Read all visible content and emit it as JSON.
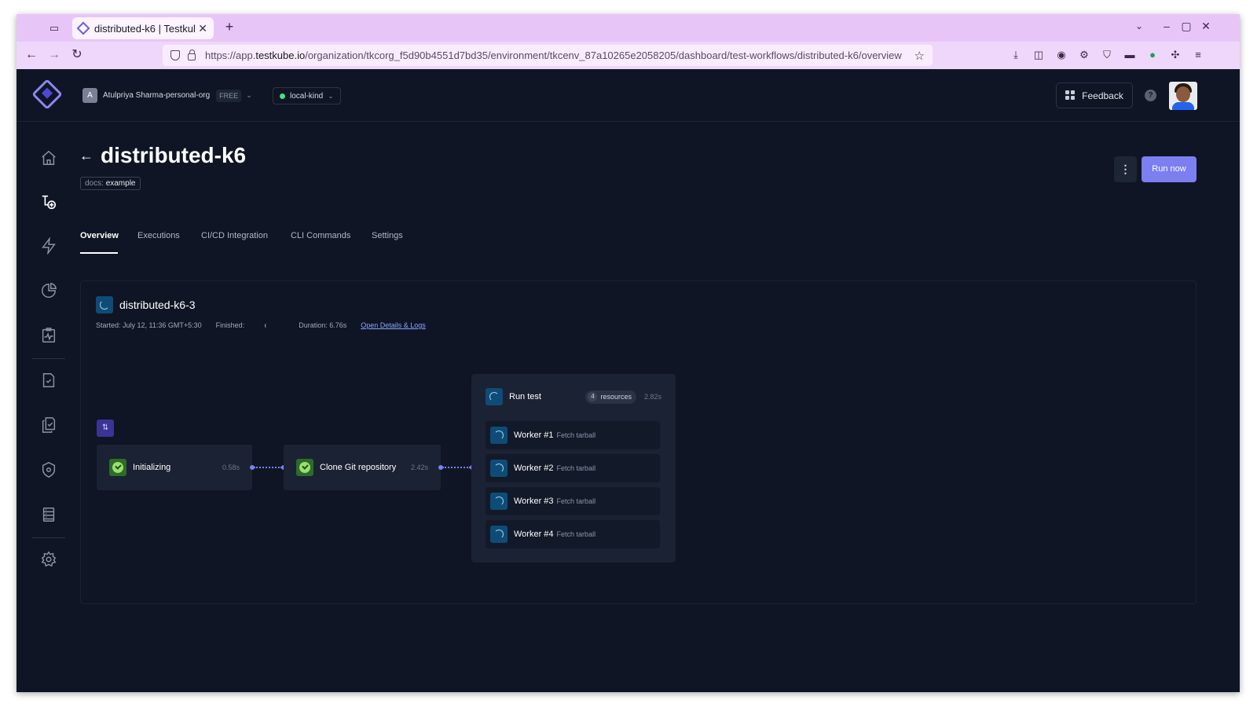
{
  "browser": {
    "tab_title": "distributed-k6 | Testkube",
    "url_prefix": "https://app.",
    "url_domain": "testkube.io",
    "url_path": "/organization/tkcorg_f5d90b4551d7bd35/environment/tkcenv_87a10265e2058205/dashboard/test-workflows/distributed-k6/overview"
  },
  "topbar": {
    "org_initial": "A",
    "org_name": "Atulpriya Sharma-personal-org",
    "org_plan": "FREE",
    "environment": "local-kind",
    "environment_status_color": "#4ade80",
    "feedback_label": "Feedback",
    "help_label": "?"
  },
  "sidebar": {
    "items": [
      "home-icon",
      "test-workflows-icon",
      "triggers-icon",
      "analytics-icon",
      "insights-icon",
      "tests-icon",
      "test-suites-icon",
      "security-icon",
      "executors-icon",
      "settings-icon"
    ],
    "active": "test-workflows-icon"
  },
  "page": {
    "title": "distributed-k6",
    "label_key": "docs: ",
    "label_value": "example",
    "run_now": "Run now",
    "more": "⋮",
    "accent_color": "#7b7ff0"
  },
  "tabs": [
    "Overview",
    "Executions",
    "CI/CD Integration",
    "CLI Commands",
    "Settings"
  ],
  "active_tab": "Overview",
  "execution": {
    "name": "distributed-k6-3",
    "started": "Started: July 12, 11:36 GMT+5:30",
    "finished": "Finished:",
    "duration": "Duration: 6.76s",
    "details_link": "Open Details & Logs",
    "steps": [
      {
        "name": "Initializing",
        "duration": "0.58s",
        "status": "passed"
      },
      {
        "name": "Clone Git repository",
        "duration": "2.42s",
        "status": "passed"
      }
    ],
    "parallel": {
      "name": "Run test",
      "resources_count": "4",
      "resources_label": "resources",
      "duration": "2.82s",
      "workers": [
        {
          "name": "Worker #1",
          "sub": "Fetch tarball"
        },
        {
          "name": "Worker #2",
          "sub": "Fetch tarball"
        },
        {
          "name": "Worker #3",
          "sub": "Fetch tarball"
        },
        {
          "name": "Worker #4",
          "sub": "Fetch tarball"
        }
      ]
    }
  }
}
